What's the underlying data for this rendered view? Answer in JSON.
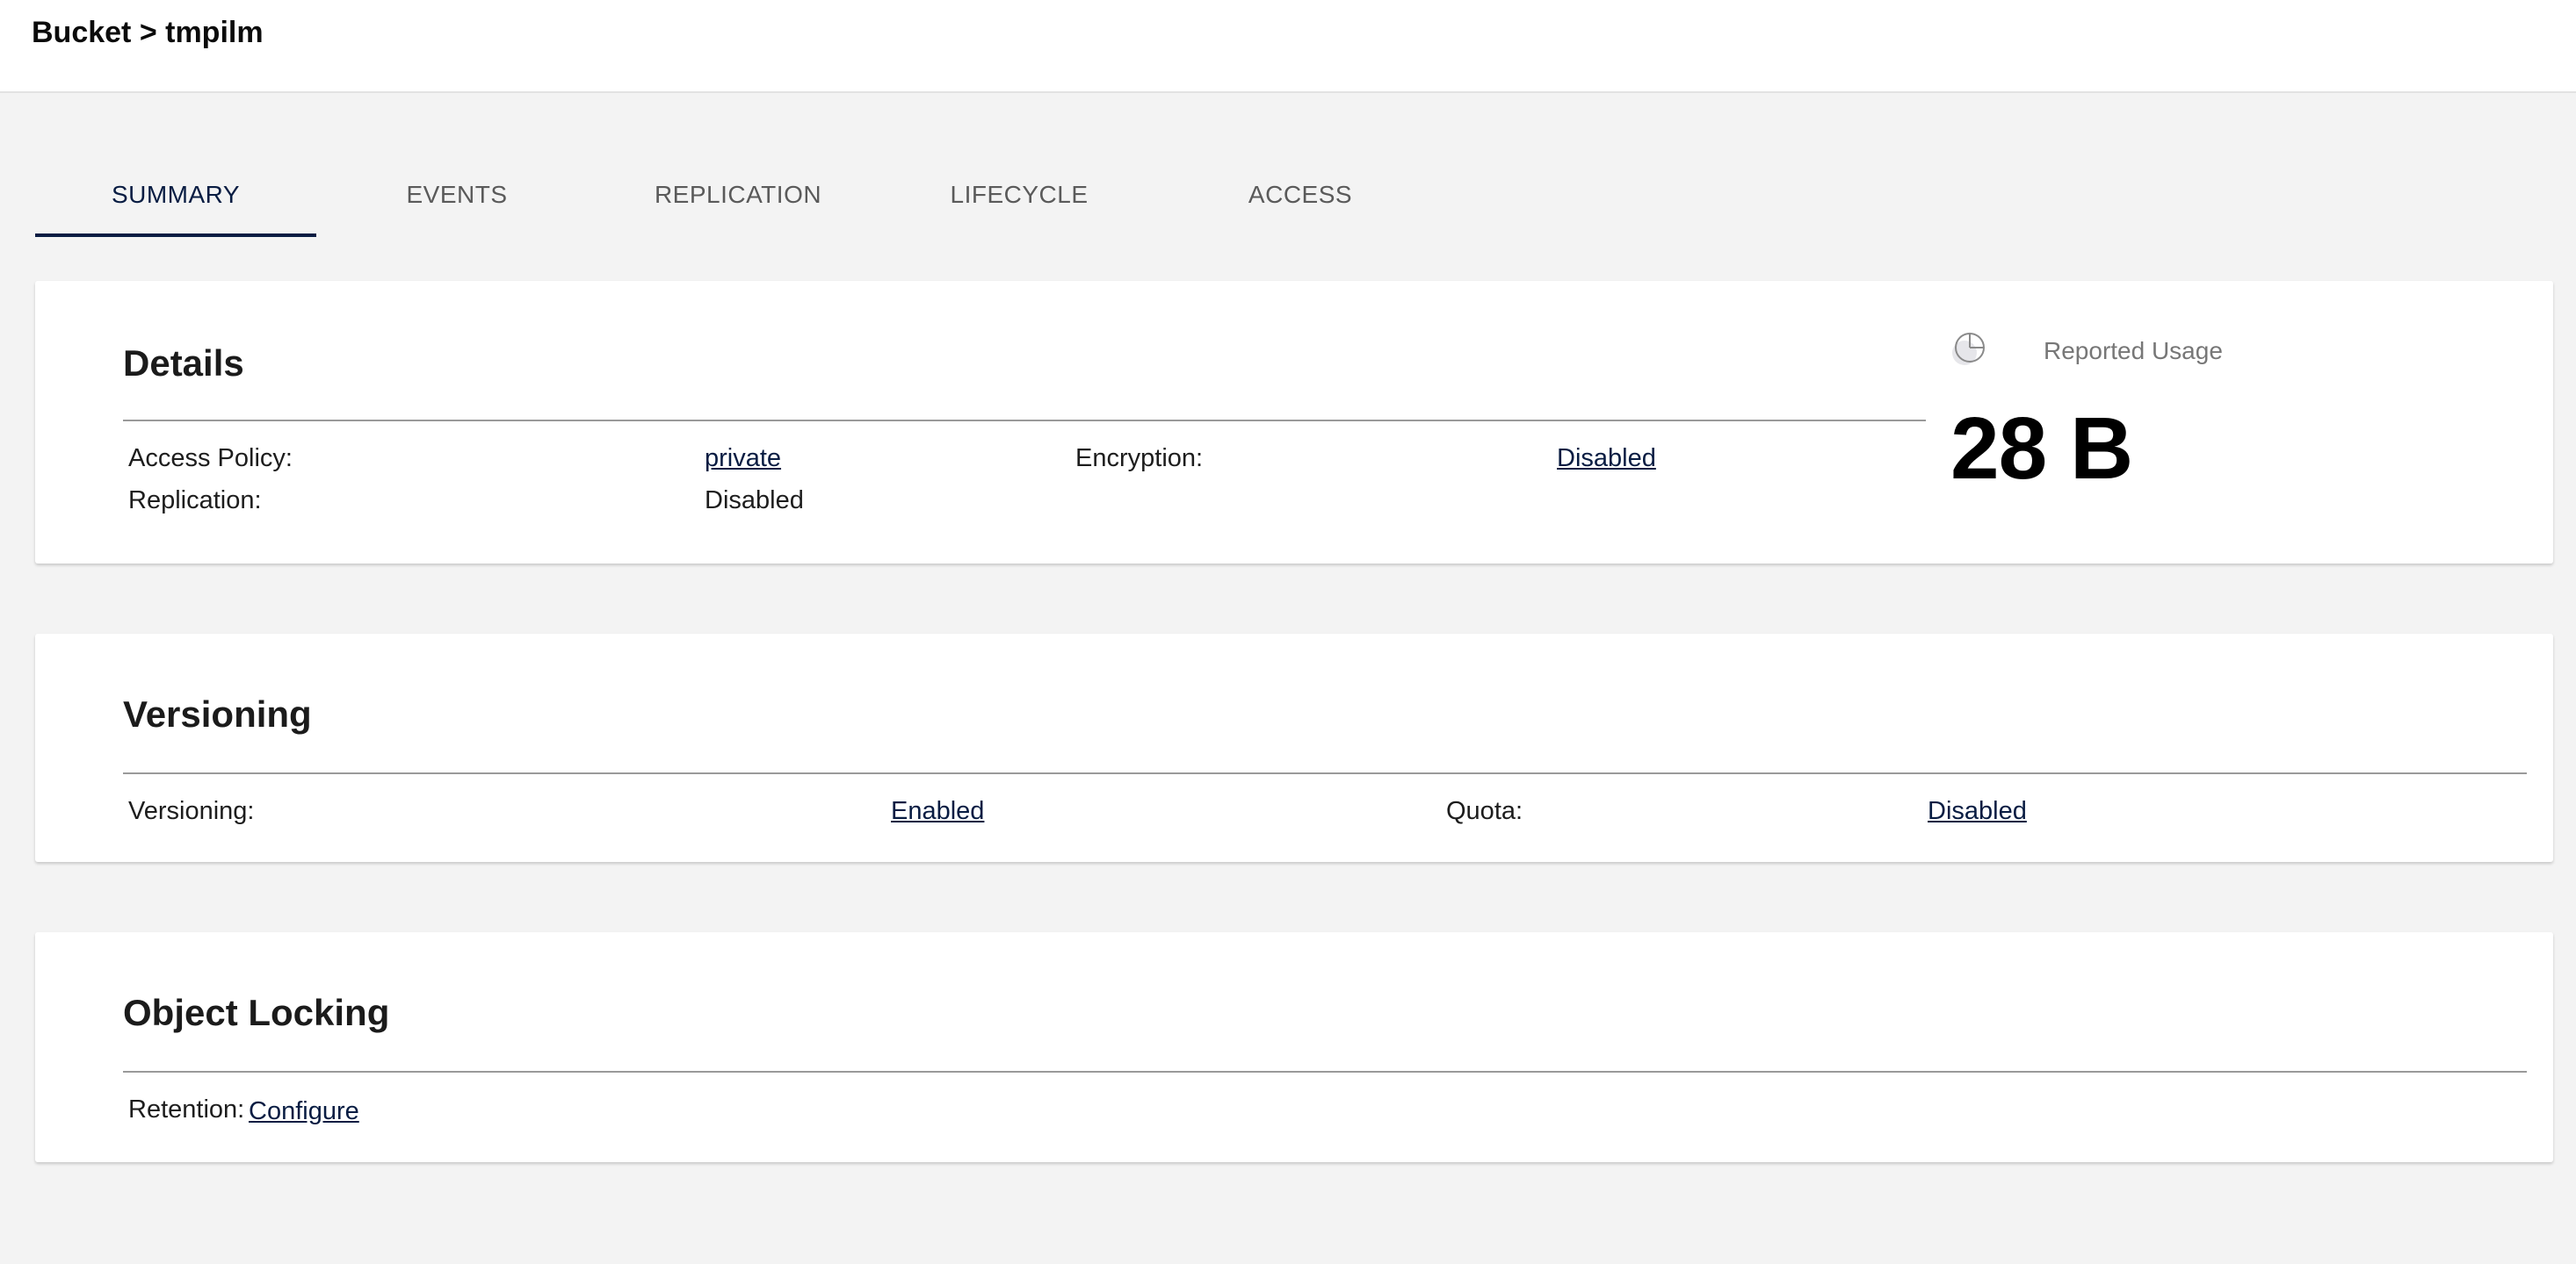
{
  "header": {
    "breadcrumb": "Bucket > tmpilm"
  },
  "tabs": [
    {
      "label": "SUMMARY",
      "active": true
    },
    {
      "label": "EVENTS",
      "active": false
    },
    {
      "label": "REPLICATION",
      "active": false
    },
    {
      "label": "LIFECYCLE",
      "active": false
    },
    {
      "label": "ACCESS",
      "active": false
    }
  ],
  "details": {
    "title": "Details",
    "access_policy_label": "Access Policy:",
    "access_policy_value": "private",
    "encryption_label": "Encryption:",
    "encryption_value": "Disabled",
    "replication_label": "Replication:",
    "replication_value": "Disabled",
    "usage": {
      "label": "Reported Usage",
      "value": "28 B",
      "icon": "pie-chart-icon"
    }
  },
  "versioning": {
    "title": "Versioning",
    "versioning_label": "Versioning:",
    "versioning_value": "Enabled",
    "quota_label": "Quota:",
    "quota_value": "Disabled"
  },
  "object_locking": {
    "title": "Object Locking",
    "retention_label": "Retention:",
    "retention_value": "Configure"
  },
  "colors": {
    "accent": "#081c42",
    "background": "#f3f3f3",
    "card": "#ffffff"
  }
}
